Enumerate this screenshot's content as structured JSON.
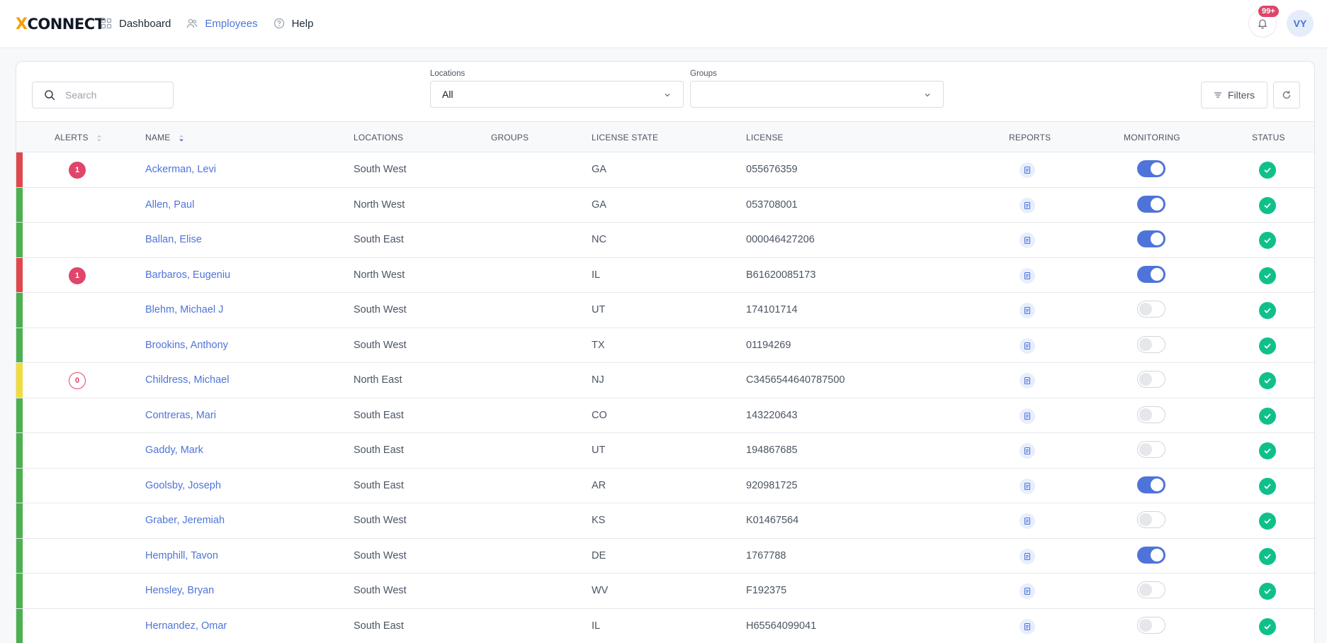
{
  "app": {
    "logo_prefix": "X",
    "logo_text": "CONNECT"
  },
  "nav": [
    {
      "label": "Dashboard",
      "icon": "grid-icon",
      "active": false
    },
    {
      "label": "Employees",
      "icon": "users-icon",
      "active": true
    },
    {
      "label": "Help",
      "icon": "help-circle-icon",
      "active": false
    }
  ],
  "header": {
    "notification_badge": "99+",
    "avatar_initials": "VY"
  },
  "toolbar": {
    "search_placeholder": "Search",
    "locations_label": "Locations",
    "locations_value": "All",
    "groups_label": "Groups",
    "groups_value": "",
    "filters_label": "Filters"
  },
  "columns": {
    "alerts": "ALERTS",
    "name": "NAME",
    "locations": "LOCATIONS",
    "groups": "GROUPS",
    "license_state": "LICENSE STATE",
    "license": "LICENSE",
    "reports": "REPORTS",
    "monitoring": "MONITORING",
    "status": "STATUS"
  },
  "colors": {
    "red": "#e0474c",
    "green": "#4caf50",
    "yellow": "#f2dc3c",
    "accent": "#4f74d9",
    "alert": "#e0456b",
    "status_ok": "#10c08a"
  },
  "rows": [
    {
      "bar": "red",
      "alert": "1",
      "alert_style": "filled",
      "name": "Ackerman, Levi",
      "location": "South West",
      "group": "",
      "state": "GA",
      "license": "055676359",
      "monitoring": true
    },
    {
      "bar": "green",
      "alert": "",
      "alert_style": "",
      "name": "Allen, Paul",
      "location": "North West",
      "group": "",
      "state": "GA",
      "license": "053708001",
      "monitoring": true
    },
    {
      "bar": "green",
      "alert": "",
      "alert_style": "",
      "name": "Ballan, Elise",
      "location": "South East",
      "group": "",
      "state": "NC",
      "license": "000046427206",
      "monitoring": true
    },
    {
      "bar": "red",
      "alert": "1",
      "alert_style": "filled",
      "name": "Barbaros, Eugeniu",
      "location": "North West",
      "group": "",
      "state": "IL",
      "license": "B61620085173",
      "monitoring": true
    },
    {
      "bar": "green",
      "alert": "",
      "alert_style": "",
      "name": "Blehm, Michael J",
      "location": "South West",
      "group": "",
      "state": "UT",
      "license": "174101714",
      "monitoring": false
    },
    {
      "bar": "green",
      "alert": "",
      "alert_style": "",
      "name": "Brookins, Anthony",
      "location": "South West",
      "group": "",
      "state": "TX",
      "license": "01194269",
      "monitoring": false
    },
    {
      "bar": "yellow",
      "alert": "0",
      "alert_style": "outline",
      "name": "Childress, Michael",
      "location": "North East",
      "group": "",
      "state": "NJ",
      "license": "C3456544640787500",
      "monitoring": false
    },
    {
      "bar": "green",
      "alert": "",
      "alert_style": "",
      "name": "Contreras, Mari",
      "location": "South East",
      "group": "",
      "state": "CO",
      "license": "143220643",
      "monitoring": false
    },
    {
      "bar": "green",
      "alert": "",
      "alert_style": "",
      "name": "Gaddy, Mark",
      "location": "South East",
      "group": "",
      "state": "UT",
      "license": "194867685",
      "monitoring": false
    },
    {
      "bar": "green",
      "alert": "",
      "alert_style": "",
      "name": "Goolsby, Joseph",
      "location": "South East",
      "group": "",
      "state": "AR",
      "license": "920981725",
      "monitoring": true
    },
    {
      "bar": "green",
      "alert": "",
      "alert_style": "",
      "name": "Graber, Jeremiah",
      "location": "South West",
      "group": "",
      "state": "KS",
      "license": "K01467564",
      "monitoring": false
    },
    {
      "bar": "green",
      "alert": "",
      "alert_style": "",
      "name": "Hemphill, Tavon",
      "location": "South West",
      "group": "",
      "state": "DE",
      "license": "1767788",
      "monitoring": true
    },
    {
      "bar": "green",
      "alert": "",
      "alert_style": "",
      "name": "Hensley, Bryan",
      "location": "South West",
      "group": "",
      "state": "WV",
      "license": "F192375",
      "monitoring": false
    },
    {
      "bar": "green",
      "alert": "",
      "alert_style": "",
      "name": "Hernandez, Omar",
      "location": "South East",
      "group": "",
      "state": "IL",
      "license": "H65564099041",
      "monitoring": false
    }
  ]
}
